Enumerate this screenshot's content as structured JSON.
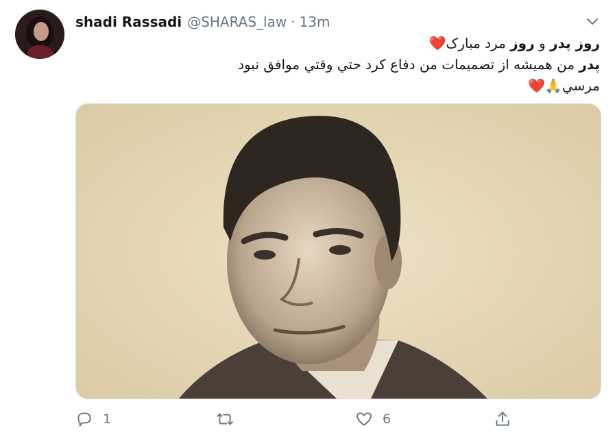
{
  "tweet": {
    "author_name": "shadi Rassadi",
    "author_handle": "@SHARAS_law",
    "separator": "·",
    "time": "13m",
    "lines": [
      {
        "b1": "روز پدر",
        "t1": " و ",
        "b2": "روز",
        "t2": " مرد مبارک",
        "emoji": "❤️"
      },
      {
        "b1": "پدر",
        "t1": " من هميشه از تصميمات من دفاع كرد حتي وقتي موافق نبود"
      },
      {
        "t1": "مرسي",
        "emoji": "🙏❤️"
      }
    ]
  },
  "actions": {
    "reply_count": "1",
    "retweet_count": "",
    "like_count": "6"
  },
  "icons": {
    "caret": "chevron-down-icon",
    "reply": "reply-icon",
    "retweet": "retweet-icon",
    "like": "heart-icon",
    "share": "share-icon"
  },
  "colors": {
    "text": "#14171a",
    "secondary": "#657786",
    "heart_emoji": "#dd2e44"
  }
}
